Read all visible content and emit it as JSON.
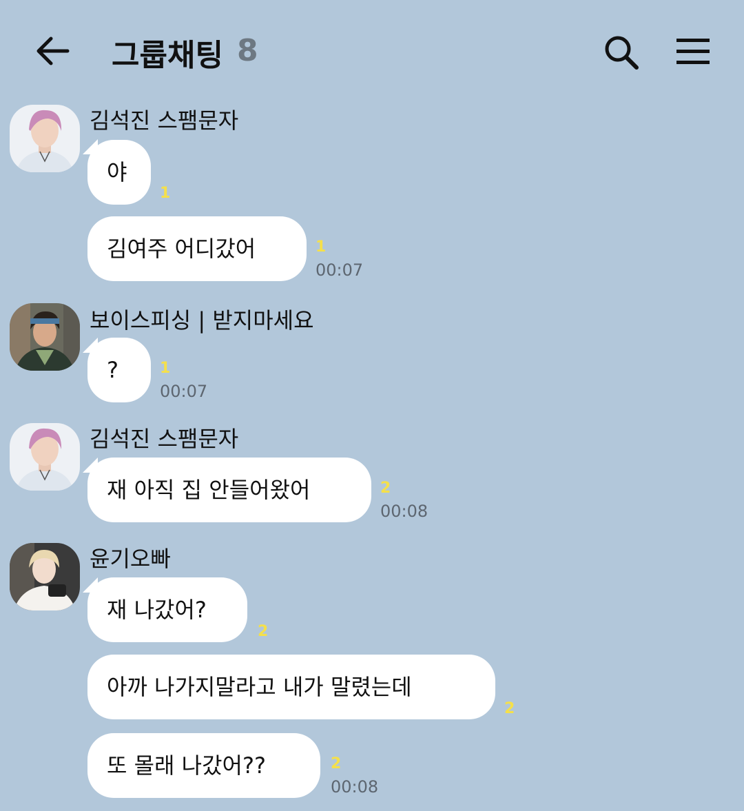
{
  "header": {
    "title": "그룹채팅",
    "member_count": "8",
    "icons": [
      "back-arrow-icon",
      "search-icon",
      "menu-icon"
    ]
  },
  "messages": [
    {
      "sender": "김석진 스팸문자",
      "text": "야",
      "unread": "1",
      "time": ""
    },
    {
      "sender": "",
      "text": "김여주 어디갔어",
      "unread": "1",
      "time": "00:07"
    },
    {
      "sender": "보이스피싱 | 받지마세요",
      "text": "?",
      "unread": "1",
      "time": "00:07"
    },
    {
      "sender": "김석진 스팸문자",
      "text": "재 아직 집 안들어왔어",
      "unread": "2",
      "time": "00:08"
    },
    {
      "sender": "윤기오빠",
      "text": "재 나갔어?",
      "unread": "2",
      "time": ""
    },
    {
      "sender": "",
      "text": "아까 나가지말라고 내가 말렸는데",
      "unread": "2",
      "time": ""
    },
    {
      "sender": "",
      "text": "또 몰래 나갔어??",
      "unread": "2",
      "time": "00:08"
    }
  ]
}
